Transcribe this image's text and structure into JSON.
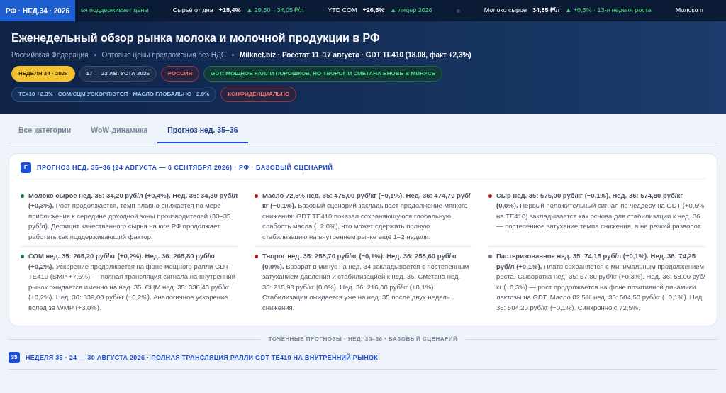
{
  "ticker": {
    "badge": "РФ · НЕД.34 · 2026",
    "items": [
      {
        "kind": "note",
        "text": "ья поддерживает цены"
      },
      {
        "kind": "quote",
        "label": "Сырьё от дна",
        "value": "+15,4%",
        "change": "▲ 29,50→34,05 ₽/л"
      },
      {
        "kind": "quote",
        "label": "YTD СОМ",
        "value": "+26,5%",
        "change": "▲ лидер 2026"
      },
      {
        "kind": "separator"
      },
      {
        "kind": "quote",
        "label": "Молоко сырое",
        "value": "34,85 ₽/л",
        "change": "▲ +0,6% · 13-я неделя роста"
      },
      {
        "kind": "label",
        "text": "Молоко п"
      }
    ]
  },
  "header": {
    "title": "Еженедельный обзор рынка молока и молочной продукции в РФ",
    "meta": [
      {
        "text": "Российская Федерация",
        "strong": false
      },
      {
        "text": "Оптовые цены предложения без НДС",
        "strong": false
      },
      {
        "text": "Milknet.biz · Росстат 11–17 августа · GDT TE410 (18.08, факт +2,3%)",
        "strong": true
      }
    ],
    "badges": [
      {
        "text": "НЕДЕЛЯ 34 · 2026",
        "kind": "gold"
      },
      {
        "text": "17 — 23 АВГУСТА 2026",
        "kind": "slate"
      },
      {
        "text": "РОССИЯ",
        "kind": "red"
      },
      {
        "text": "GDT: МОЩНОЕ РАЛЛИ ПОРОШКОВ, НО ТВОРОГ И СМЕТАНА ВНОВЬ В МИНУСЕ",
        "kind": "green"
      },
      {
        "text": "TE410 +2,3% · СОМ/СЦМ УСКОРЯЮТСЯ · МАСЛО ГЛОБАЛЬНО −2,0%",
        "kind": "blue"
      },
      {
        "text": "КОНФИДЕНЦИАЛЬНО",
        "kind": "red"
      }
    ]
  },
  "tabs": [
    {
      "label": "Все категории",
      "selected": false
    },
    {
      "label": "WoW-динамика",
      "selected": false
    },
    {
      "label": "Прогноз нед. 35–36",
      "selected": true
    }
  ],
  "forecast": {
    "icon": "F",
    "title": "ПРОГНОЗ НЕД. 35–36 (24 АВГУСТА — 6 СЕНТЯБРЯ 2026) · РФ · БАЗОВЫЙ СЦЕНАРИЙ",
    "items": [
      {
        "color": "#15803d",
        "text": "**Молоко сырое нед. 35: 34,20 руб/л (+0,4%). Нед. 36: 34,30 руб/л (+0,3%).** Рост продолжается, темп плавно снижается по мере приближения к середине доходной зоны производителей (33–35 руб/л). Дефицит качественного сырья на юге РФ продолжает работать как поддерживающий фактор."
      },
      {
        "color": "#b91c1c",
        "text": "**Масло 72,5% нед. 35: 475,00 руб/кг (−0,1%). Нед. 36: 474,70 руб/кг (−0,1%).** Базовый сценарий закладывает продолжение мягкого снижения: GDT TE410 показал сохраняющуюся глобальную слабость масла (−2,0%), что может сдержать полную стабилизацию на внутреннем рынке ещё 1–2 недели."
      },
      {
        "color": "#b91c1c",
        "text": "**Сыр нед. 35: 575,00 руб/кг (−0,1%). Нед. 36: 574,80 руб/кг (0,0%).** Первый положительный сигнал по чеддеру на GDT (+0,6% на TE410) закладывается как основа для стабилизации к нед. 36 — постепенное затухание темпа снижения, а не резкий разворот."
      },
      {
        "color": "#15803d",
        "text": "**СОМ нед. 35: 265,20 руб/кг (+0,2%). Нед. 36: 265,80 руб/кг (+0,2%).** Ускорение продолжается на фоне мощного ралли GDT TE410 (SMP +7,6%) — полная трансляция сигнала на внутренний рынок ожидается именно на нед. 35. СЦМ нед. 35: 338,40 руб/кг (+0,2%). Нед. 36: 339,00 руб/кг (+0,2%). Аналогичное ускорение вслед за WMP (+3,0%)."
      },
      {
        "color": "#b91c1c",
        "text": "**Творог нед. 35: 258,70 руб/кг (−0,1%). Нед. 36: 258,60 руб/кг (0,0%).** Возврат в минус на нед. 34 закладывается с постепенным затуханием давления и стабилизацией к нед. 36. Сметана нед. 35: 215,90 руб/кг (0,0%). Нед. 36: 216,00 руб/кг (+0,1%). Стабилизация ожидается уже на нед. 35 после двух недель снижения."
      },
      {
        "color": "#64748b",
        "text": "**Пастеризованное нед. 35: 74,15 руб/л (+0,1%). Нед. 36: 74,25 руб/л (+0,1%).** Плато сохраняется с минимальным продолжением роста. Сыворотка нед. 35: 57,80 руб/кг (+0,3%). Нед. 36: 58,00 руб/кг (+0,3%) — рост продолжается на фоне позитивной динамики лактозы на GDT. Масло 82,5% нед. 35: 504,50 руб/кг (−0,1%). Нед. 36: 504,20 руб/кг (−0,1%). Синхронно с 72,5%."
      }
    ]
  },
  "divider": "ТОЧЕЧНЫЕ ПРОГНОЗЫ · НЕД. 35–36 · БАЗОВЫЙ СЦЕНАРИЙ",
  "week": {
    "number": "35",
    "title": "НЕДЕЛЯ 35 · 24 — 30 АВГУСТА 2026 · ПОЛНАЯ ТРАНСЛЯЦИЯ РАЛЛИ GDT TE410 НА ВНУТРЕННИЙ РЫНОК"
  }
}
